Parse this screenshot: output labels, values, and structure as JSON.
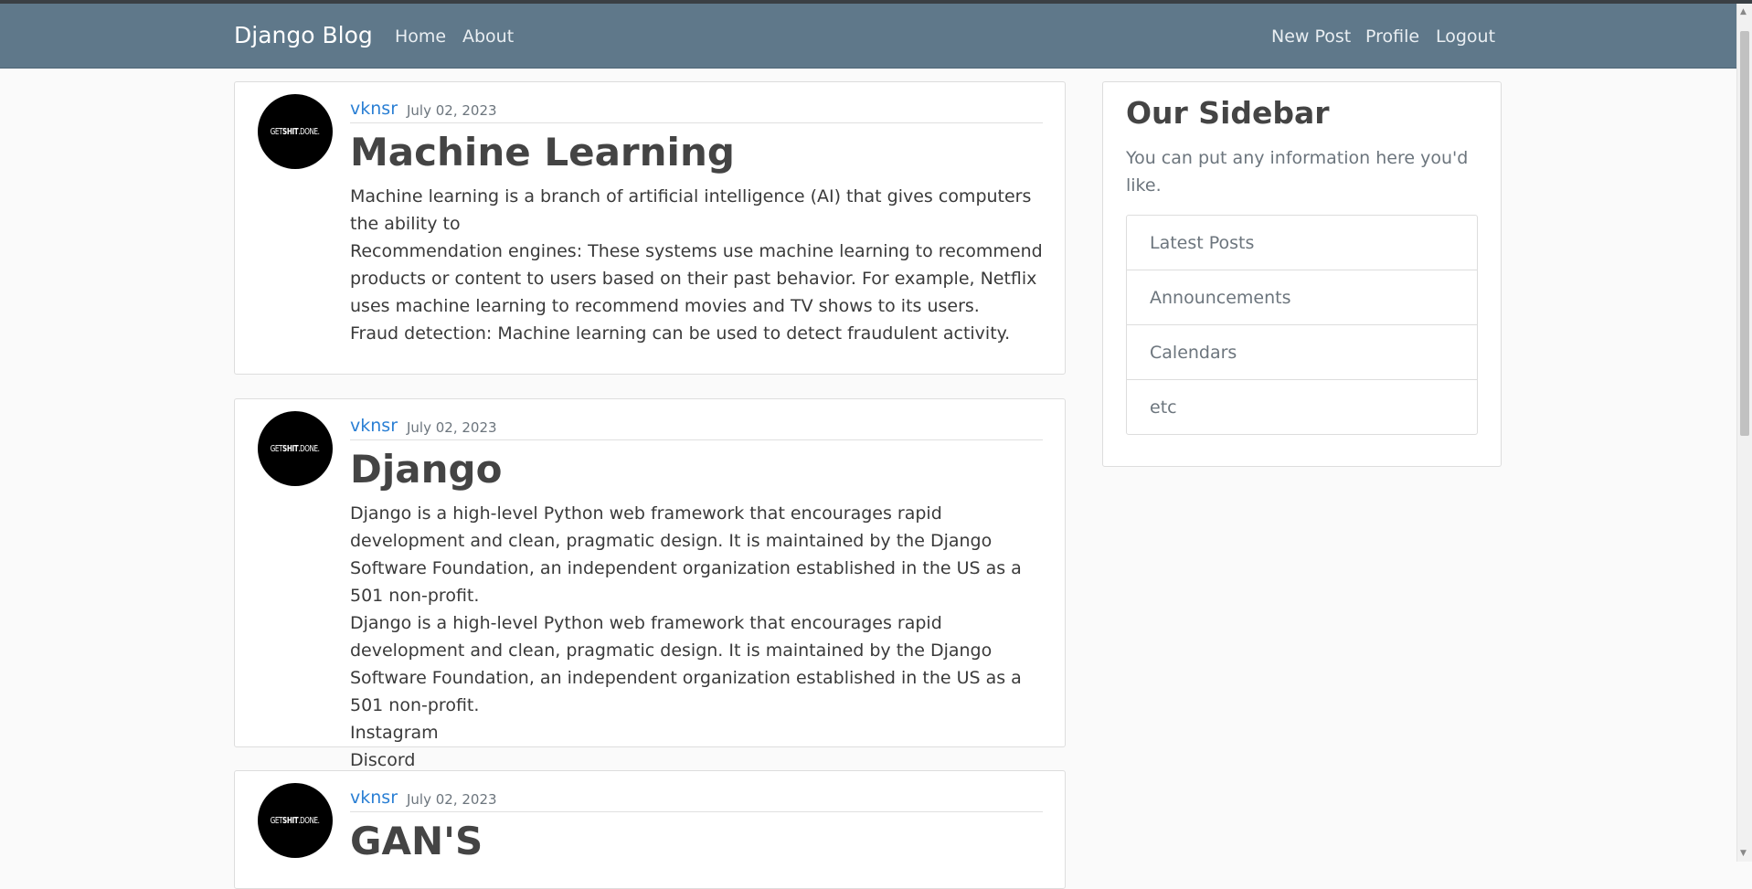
{
  "navbar": {
    "brand": "Django Blog",
    "left_links": [
      "Home",
      "About"
    ],
    "right_links": [
      "New Post",
      "Profile",
      "Logout"
    ]
  },
  "avatar_text": {
    "prefix": "GET",
    "bold": "SHIT",
    "suffix": ".DONE."
  },
  "posts": [
    {
      "author": "vknsr",
      "date": "July 02, 2023",
      "title": "Machine Learning",
      "paragraphs": [
        "Machine learning is a branch of artificial intelligence (AI) that gives computers the ability to",
        "Recommendation engines: These systems use machine learning to recommend products or content to users based on their past behavior. For example, Netflix uses machine learning to recommend movies and TV shows to its users.",
        "Fraud detection: Machine learning can be used to detect fraudulent activity."
      ]
    },
    {
      "author": "vknsr",
      "date": "July 02, 2023",
      "title": "Django",
      "paragraphs": [
        "Django is a high-level Python web framework that encourages rapid development and clean, pragmatic design. It is maintained by the Django Software Foundation, an independent organization established in the US as a 501 non-profit.",
        "Django is a high-level Python web framework that encourages rapid development and clean, pragmatic design. It is maintained by the Django Software Foundation, an independent organization established in the US as a 501 non-profit.",
        "Instagram",
        "Discord"
      ]
    },
    {
      "author": "vknsr",
      "date": "July 02, 2023",
      "title": "GAN'S"
    }
  ],
  "sidebar": {
    "title": "Our Sidebar",
    "text": "You can put any information here you'd like.",
    "items": [
      "Latest Posts",
      "Announcements",
      "Calendars",
      "etc"
    ]
  },
  "colors": {
    "navbar_bg": "#5f788a",
    "author_link": "#2a7fd4",
    "page_bg": "#fafafa"
  }
}
